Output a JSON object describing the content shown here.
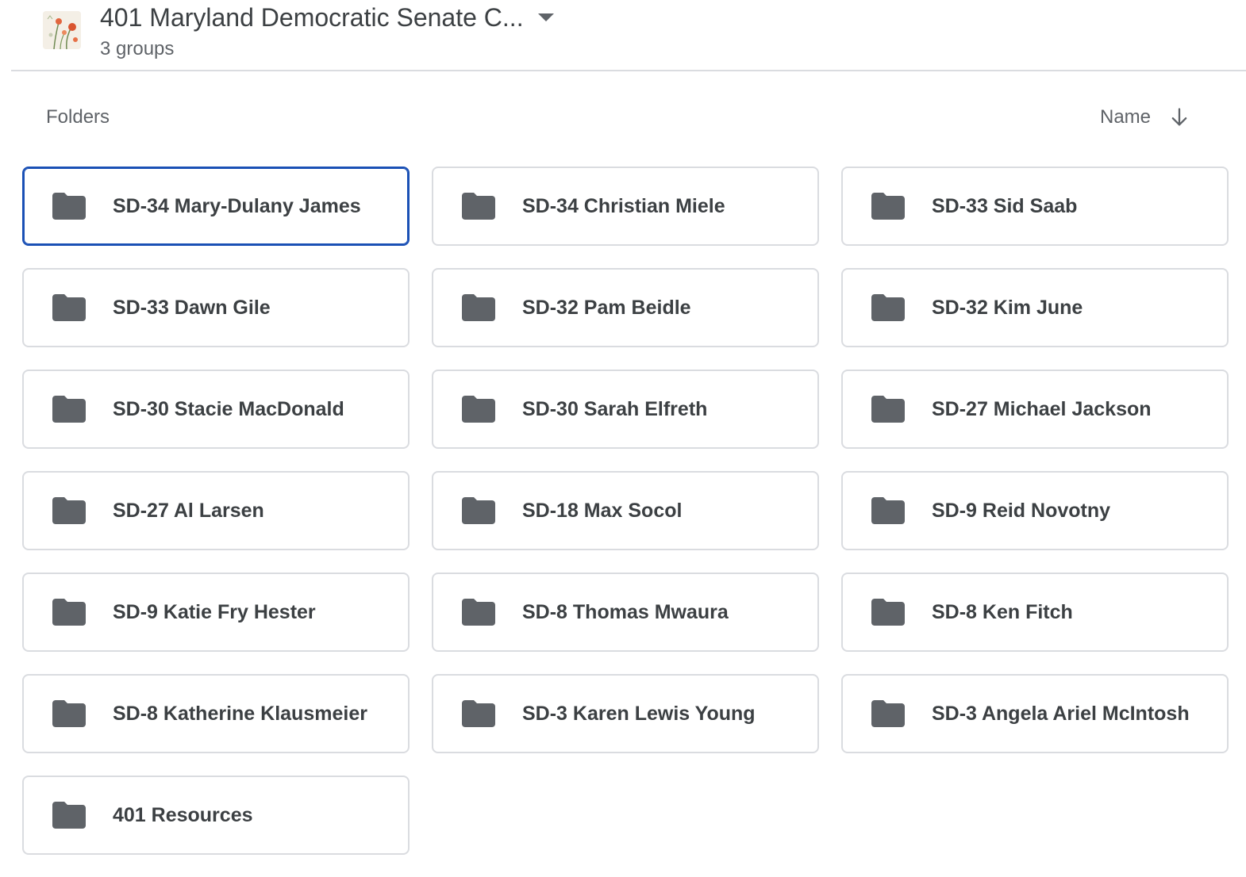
{
  "header": {
    "title": "401 Maryland Democratic Senate C...",
    "subtitle": "3 groups"
  },
  "folders_section": {
    "label": "Folders",
    "sort_label": "Name",
    "sort_icon": "arrow-down-icon"
  },
  "folders": [
    {
      "name": "SD-34 Mary-Dulany James",
      "selected": true
    },
    {
      "name": "SD-34 Christian Miele"
    },
    {
      "name": "SD-33 Sid Saab"
    },
    {
      "name": "SD-33 Dawn Gile"
    },
    {
      "name": "SD-32 Pam Beidle"
    },
    {
      "name": "SD-32 Kim June"
    },
    {
      "name": "SD-30 Stacie MacDonald"
    },
    {
      "name": "SD-30 Sarah Elfreth"
    },
    {
      "name": "SD-27 Michael Jackson"
    },
    {
      "name": "SD-27 Al Larsen"
    },
    {
      "name": "SD-18 Max Socol"
    },
    {
      "name": "SD-9 Reid Novotny"
    },
    {
      "name": "SD-9 Katie Fry Hester"
    },
    {
      "name": "SD-8 Thomas Mwaura"
    },
    {
      "name": "SD-8 Ken Fitch"
    },
    {
      "name": "SD-8 Katherine Klausmeier"
    },
    {
      "name": "SD-3 Karen Lewis Young"
    },
    {
      "name": "SD-3 Angela Ariel McIntosh"
    },
    {
      "name": "401 Resources"
    }
  ],
  "colors": {
    "selected_border": "#1a50b5",
    "card_border": "#dadce0",
    "folder_icon": "#5f6368",
    "text": "#3c4043"
  }
}
